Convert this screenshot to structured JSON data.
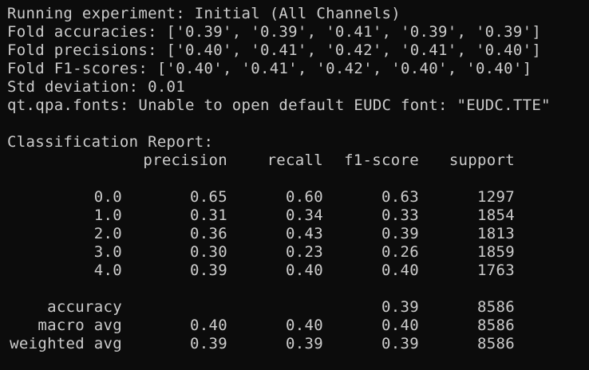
{
  "log_lines": [
    "Running experiment: Initial (All Channels)",
    "Fold accuracies: ['0.39', '0.39', '0.41', '0.39', '0.39']",
    "Fold precisions: ['0.40', '0.41', '0.42', '0.41', '0.40']",
    "Fold F1-scores: ['0.40', '0.41', '0.42', '0.40', '0.40']",
    "Std deviation: 0.01",
    "qt.qpa.fonts: Unable to open default EUDC font: \"EUDC.TTE\""
  ],
  "report": {
    "title": "Classification Report:",
    "headers": [
      "precision",
      "recall",
      "f1-score",
      "support"
    ],
    "class_rows": [
      {
        "label": "0.0",
        "precision": "0.65",
        "recall": "0.60",
        "f1": "0.63",
        "support": "1297"
      },
      {
        "label": "1.0",
        "precision": "0.31",
        "recall": "0.34",
        "f1": "0.33",
        "support": "1854"
      },
      {
        "label": "2.0",
        "precision": "0.36",
        "recall": "0.43",
        "f1": "0.39",
        "support": "1813"
      },
      {
        "label": "3.0",
        "precision": "0.30",
        "recall": "0.23",
        "f1": "0.26",
        "support": "1859"
      },
      {
        "label": "4.0",
        "precision": "0.39",
        "recall": "0.40",
        "f1": "0.40",
        "support": "1763"
      }
    ],
    "summary_rows": [
      {
        "label": "accuracy",
        "precision": "",
        "recall": "",
        "f1": "0.39",
        "support": "8586"
      },
      {
        "label": "macro avg",
        "precision": "0.40",
        "recall": "0.40",
        "f1": "0.40",
        "support": "8586"
      },
      {
        "label": "weighted avg",
        "precision": "0.39",
        "recall": "0.39",
        "f1": "0.39",
        "support": "8586"
      }
    ]
  },
  "colors": {
    "background": "#0c0c0c",
    "foreground": "#cccccc"
  }
}
